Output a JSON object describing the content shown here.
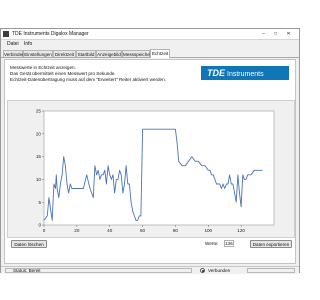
{
  "window": {
    "title": "TDE Instruments Digalox Manager"
  },
  "menu": [
    "Datei",
    "Info"
  ],
  "tabs": [
    "Verbinden",
    "Einstellungen",
    "Direktzeit",
    "Startbild",
    "Anzeigebild",
    "Messspeicher",
    "Echtzeit"
  ],
  "active_tab": 6,
  "info_lines": [
    "Messwerte in Echtzeit anzeigen.",
    "Das Gerät übermittelt einen Messwert pro Sekunde.",
    "Echtzeit-Datenübertragung muss auf dem \"Erweitert\" Reiter aktiviert werden."
  ],
  "logo": {
    "brand": "TDE",
    "rest": "Instruments"
  },
  "buttons": {
    "clear": "Daten löschen",
    "export": "Daten exportieren"
  },
  "value": {
    "label": "Werte:",
    "count": "136"
  },
  "status": {
    "text": "Status: Bereit",
    "connection": "Verbunden"
  },
  "colors": {
    "line": "#4a74b8",
    "logo_bg": "#0f76b7"
  },
  "chart_data": {
    "type": "line",
    "x": [
      0,
      2,
      3,
      5,
      6,
      7,
      7.5,
      8,
      9,
      10,
      11,
      12,
      13,
      14,
      15,
      16,
      17,
      18,
      20,
      22,
      24,
      26,
      28,
      30,
      31,
      32,
      33,
      34,
      35,
      36,
      37,
      38,
      39,
      40,
      41,
      42,
      43,
      44,
      45,
      46,
      47,
      48,
      49,
      50,
      51,
      52,
      53,
      54,
      55,
      56,
      57,
      58,
      59,
      60,
      62,
      65,
      70,
      75,
      78,
      80,
      81,
      82,
      84,
      86,
      88,
      90,
      92,
      94,
      96,
      98,
      100,
      101,
      102,
      103,
      104,
      105,
      106,
      107,
      108,
      109,
      110,
      111,
      112,
      113,
      114,
      115,
      116,
      117,
      118,
      119,
      120,
      121,
      122,
      123,
      124,
      125,
      126,
      128,
      130,
      132,
      133
    ],
    "y": [
      1,
      2,
      6,
      1,
      9,
      8,
      11,
      8,
      6,
      9,
      11,
      15,
      13,
      9,
      7,
      9,
      8,
      8,
      8,
      8,
      8,
      11,
      8,
      6,
      13,
      11,
      12,
      10,
      11,
      11,
      12,
      9,
      13,
      11,
      10,
      11,
      7,
      10,
      10,
      12,
      11,
      7,
      9,
      13,
      9,
      9,
      5,
      3,
      2,
      1,
      1,
      2,
      2,
      21,
      21,
      21,
      21,
      21,
      21,
      21,
      18,
      14,
      13,
      13,
      14,
      15,
      14,
      14,
      13,
      13,
      12,
      12,
      11,
      11,
      10,
      9,
      9,
      9,
      8,
      9,
      8,
      9,
      9,
      11,
      9,
      9,
      7,
      5,
      11,
      7,
      4,
      11,
      10,
      10,
      11,
      11,
      11,
      12,
      12,
      12,
      12
    ],
    "xlim": [
      0,
      140
    ],
    "ylim": [
      0,
      25
    ],
    "xticks": [
      0,
      20,
      40,
      60,
      80,
      100,
      120
    ],
    "yticks": [
      0,
      5,
      10,
      15,
      20,
      25
    ],
    "grid": false
  }
}
